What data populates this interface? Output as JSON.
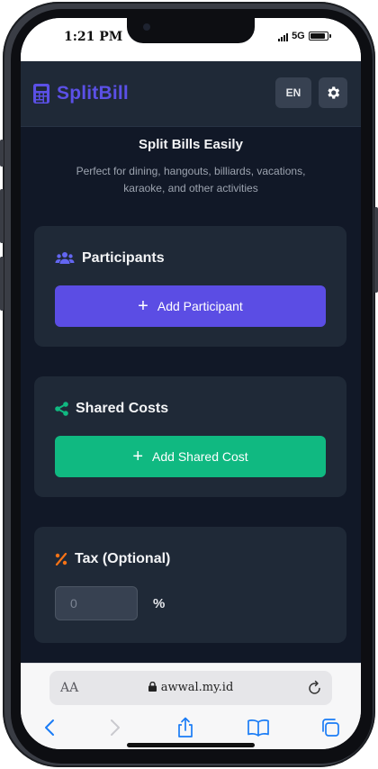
{
  "status_bar": {
    "time": "1:21 PM",
    "network": "5G"
  },
  "app": {
    "brand": "SplitBill",
    "language_button": "EN",
    "hero": {
      "title": "Split Bills Easily",
      "subtitle": "Perfect for dining, hangouts, billiards, vacations, karaoke, and other activities"
    },
    "participants": {
      "title": "Participants",
      "add_button": "Add Participant"
    },
    "shared_costs": {
      "title": "Shared Costs",
      "add_button": "Add Shared Cost"
    },
    "tax": {
      "title": "Tax (Optional)",
      "placeholder": "0",
      "unit": "%"
    }
  },
  "browser": {
    "text_size_label": "AA",
    "url": "awwal.my.id"
  },
  "icons": {
    "brand": "calculator-icon",
    "theme": "gear-icon",
    "participants": "users-icon",
    "shared_costs": "share-icon",
    "tax": "percent-icon",
    "lock": "lock-icon",
    "reload": "reload-icon",
    "back": "back-icon",
    "forward": "forward-icon",
    "share": "share-sheet-icon",
    "bookmarks": "bookmarks-icon",
    "tabs": "tabs-icon"
  },
  "colors": {
    "background": "#111827",
    "card": "#1f2937",
    "brand": "#5b50e6",
    "primary_button": "#5b4de4",
    "success_button": "#10b981",
    "tax_icon": "#f97316",
    "safari_accent": "#1a7cf5"
  }
}
